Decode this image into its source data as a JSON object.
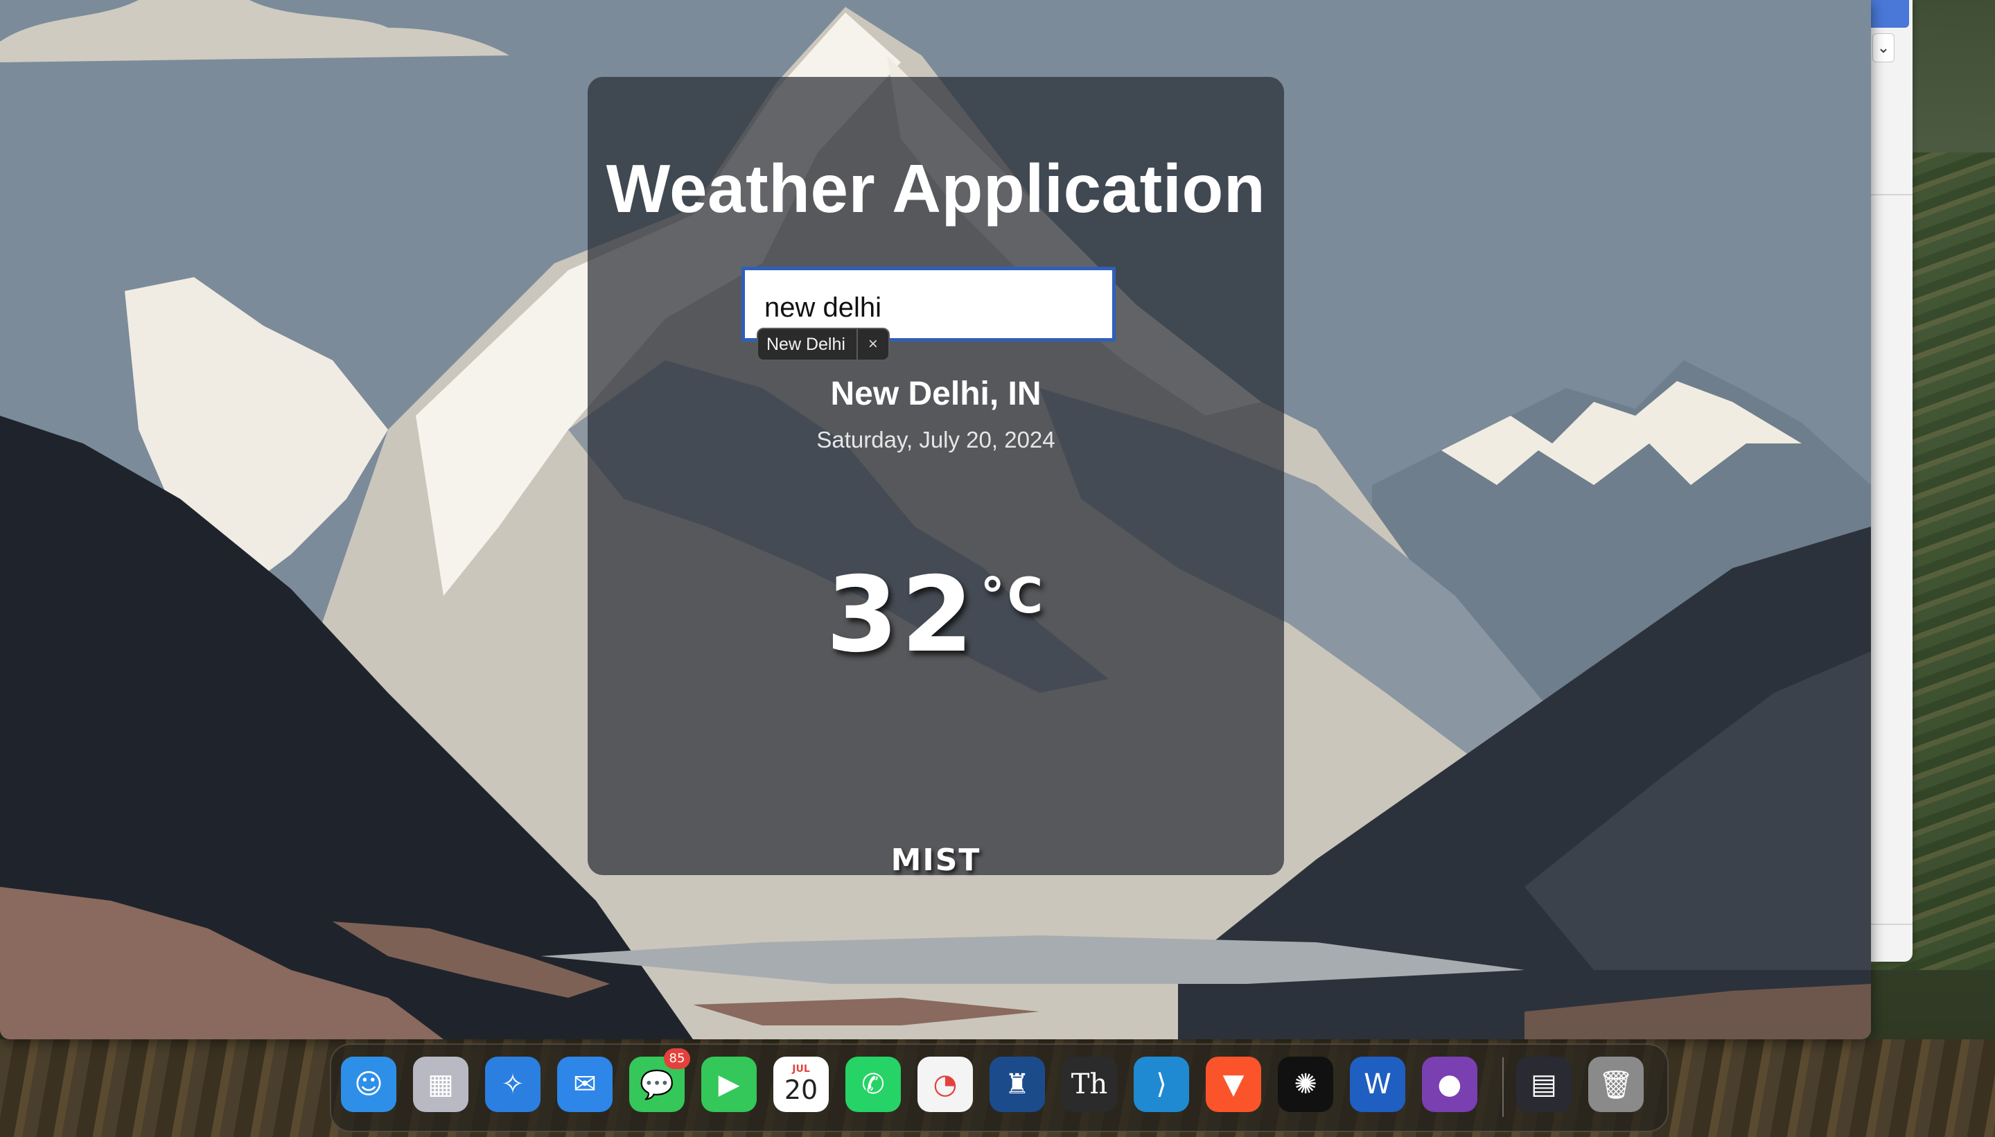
{
  "app": {
    "title": "Weather Application"
  },
  "search": {
    "value": "new delhi",
    "autofill_suggestion": "New Delhi",
    "autofill_close": "×"
  },
  "location": {
    "city": "New Delhi, IN",
    "date": "Saturday, July 20, 2024"
  },
  "weather": {
    "temperature": "32",
    "unit": "°C",
    "condition": "MIST"
  },
  "colors": {
    "card_bg": "#2a2e36",
    "input_border": "#2f5fb7",
    "sky": "#7b8b9a"
  },
  "dock": {
    "items": [
      {
        "name": "finder",
        "icon": "finder-icon",
        "glyph": "☺",
        "color": "#2e8fe8"
      },
      {
        "name": "launchpad",
        "icon": "launchpad-icon",
        "glyph": "▦",
        "color": "#b9b9c4"
      },
      {
        "name": "safari",
        "icon": "safari-icon",
        "glyph": "✧",
        "color": "#2a7fe0"
      },
      {
        "name": "mail",
        "icon": "mail-icon",
        "glyph": "✉",
        "color": "#2d86e8"
      },
      {
        "name": "messages",
        "icon": "messages-icon",
        "glyph": "💬",
        "color": "#35c759",
        "badge": "85"
      },
      {
        "name": "facetime",
        "icon": "facetime-icon",
        "glyph": "▶",
        "color": "#34c759"
      },
      {
        "name": "calendar",
        "icon": "calendar-icon",
        "glyph": "20",
        "color": "#ffffff",
        "sub": "JUL"
      },
      {
        "name": "whatsapp",
        "icon": "whatsapp-icon",
        "glyph": "✆",
        "color": "#25d366"
      },
      {
        "name": "screen-time",
        "icon": "timer-icon",
        "glyph": "◔",
        "color": "#f4f4f4"
      },
      {
        "name": "kindle",
        "icon": "kindle-icon",
        "glyph": "♜",
        "color": "#1c4b8c"
      },
      {
        "name": "thesaurus",
        "icon": "thesaurus-icon",
        "glyph": "Th",
        "color": "#2b2b2b"
      },
      {
        "name": "vscode",
        "icon": "vscode-icon",
        "glyph": "⟩",
        "color": "#1f8ad2"
      },
      {
        "name": "brave",
        "icon": "brave-icon",
        "glyph": "▼",
        "color": "#fb542b"
      },
      {
        "name": "chatgpt",
        "icon": "chatgpt-icon",
        "glyph": "✺",
        "color": "#111111"
      },
      {
        "name": "word",
        "icon": "word-icon",
        "glyph": "W",
        "color": "#1f5fc1"
      },
      {
        "name": "github-desktop",
        "icon": "github-icon",
        "glyph": "●",
        "color": "#7a3fb1"
      },
      {
        "name": "window-preview",
        "icon": "window-preview-icon",
        "glyph": "▤",
        "color": "#2a2a33"
      },
      {
        "name": "trash",
        "icon": "trash-icon",
        "glyph": "🗑",
        "color": "#8a8a8a"
      }
    ]
  }
}
